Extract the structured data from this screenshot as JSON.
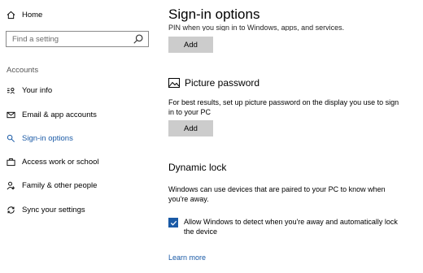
{
  "sidebar": {
    "home_label": "Home",
    "search_placeholder": "Find a setting",
    "section_label": "Accounts",
    "items": [
      {
        "label": "Your info",
        "icon": "user-card-icon"
      },
      {
        "label": "Email & app accounts",
        "icon": "envelope-icon"
      },
      {
        "label": "Sign-in options",
        "icon": "key-icon",
        "active": true
      },
      {
        "label": "Access work or school",
        "icon": "briefcase-icon"
      },
      {
        "label": "Family & other people",
        "icon": "people-icon"
      },
      {
        "label": "Sync your settings",
        "icon": "sync-icon"
      }
    ]
  },
  "main": {
    "title": "Sign-in options",
    "pin_cut_text": "PIN when you sign in to Windows, apps, and services.",
    "pin_add_label": "Add",
    "picture_password": {
      "title": "Picture password",
      "icon": "picture-icon",
      "description": "For best results, set up picture password on the display you use to sign in to your PC",
      "add_label": "Add"
    },
    "dynamic_lock": {
      "title": "Dynamic lock",
      "description": "Windows can use devices that are paired to your PC to know when you're away.",
      "checkbox_label": "Allow Windows to detect when you're away and automatically lock the device",
      "checkbox_checked": true,
      "learn_more": "Learn more"
    }
  },
  "colors": {
    "accent": "#1a5aa6",
    "button_bg": "#cccccc"
  }
}
